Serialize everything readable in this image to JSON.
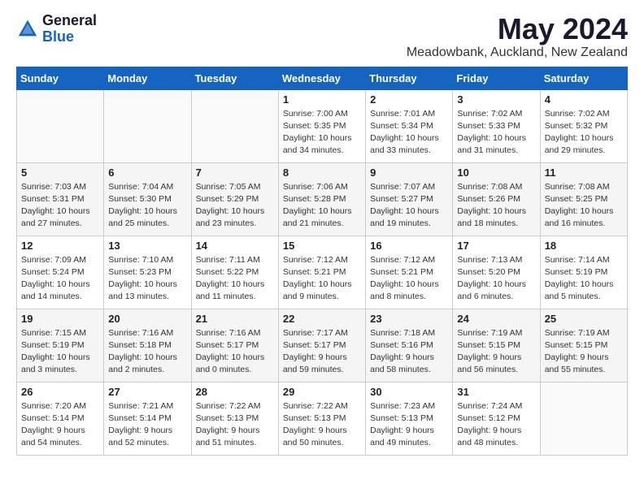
{
  "logo": {
    "general": "General",
    "blue": "Blue"
  },
  "title": "May 2024",
  "location": "Meadowbank, Auckland, New Zealand",
  "headers": [
    "Sunday",
    "Monday",
    "Tuesday",
    "Wednesday",
    "Thursday",
    "Friday",
    "Saturday"
  ],
  "weeks": [
    [
      {
        "day": "",
        "info": ""
      },
      {
        "day": "",
        "info": ""
      },
      {
        "day": "",
        "info": ""
      },
      {
        "day": "1",
        "info": "Sunrise: 7:00 AM\nSunset: 5:35 PM\nDaylight: 10 hours\nand 34 minutes."
      },
      {
        "day": "2",
        "info": "Sunrise: 7:01 AM\nSunset: 5:34 PM\nDaylight: 10 hours\nand 33 minutes."
      },
      {
        "day": "3",
        "info": "Sunrise: 7:02 AM\nSunset: 5:33 PM\nDaylight: 10 hours\nand 31 minutes."
      },
      {
        "day": "4",
        "info": "Sunrise: 7:02 AM\nSunset: 5:32 PM\nDaylight: 10 hours\nand 29 minutes."
      }
    ],
    [
      {
        "day": "5",
        "info": "Sunrise: 7:03 AM\nSunset: 5:31 PM\nDaylight: 10 hours\nand 27 minutes."
      },
      {
        "day": "6",
        "info": "Sunrise: 7:04 AM\nSunset: 5:30 PM\nDaylight: 10 hours\nand 25 minutes."
      },
      {
        "day": "7",
        "info": "Sunrise: 7:05 AM\nSunset: 5:29 PM\nDaylight: 10 hours\nand 23 minutes."
      },
      {
        "day": "8",
        "info": "Sunrise: 7:06 AM\nSunset: 5:28 PM\nDaylight: 10 hours\nand 21 minutes."
      },
      {
        "day": "9",
        "info": "Sunrise: 7:07 AM\nSunset: 5:27 PM\nDaylight: 10 hours\nand 19 minutes."
      },
      {
        "day": "10",
        "info": "Sunrise: 7:08 AM\nSunset: 5:26 PM\nDaylight: 10 hours\nand 18 minutes."
      },
      {
        "day": "11",
        "info": "Sunrise: 7:08 AM\nSunset: 5:25 PM\nDaylight: 10 hours\nand 16 minutes."
      }
    ],
    [
      {
        "day": "12",
        "info": "Sunrise: 7:09 AM\nSunset: 5:24 PM\nDaylight: 10 hours\nand 14 minutes."
      },
      {
        "day": "13",
        "info": "Sunrise: 7:10 AM\nSunset: 5:23 PM\nDaylight: 10 hours\nand 13 minutes."
      },
      {
        "day": "14",
        "info": "Sunrise: 7:11 AM\nSunset: 5:22 PM\nDaylight: 10 hours\nand 11 minutes."
      },
      {
        "day": "15",
        "info": "Sunrise: 7:12 AM\nSunset: 5:21 PM\nDaylight: 10 hours\nand 9 minutes."
      },
      {
        "day": "16",
        "info": "Sunrise: 7:12 AM\nSunset: 5:21 PM\nDaylight: 10 hours\nand 8 minutes."
      },
      {
        "day": "17",
        "info": "Sunrise: 7:13 AM\nSunset: 5:20 PM\nDaylight: 10 hours\nand 6 minutes."
      },
      {
        "day": "18",
        "info": "Sunrise: 7:14 AM\nSunset: 5:19 PM\nDaylight: 10 hours\nand 5 minutes."
      }
    ],
    [
      {
        "day": "19",
        "info": "Sunrise: 7:15 AM\nSunset: 5:19 PM\nDaylight: 10 hours\nand 3 minutes."
      },
      {
        "day": "20",
        "info": "Sunrise: 7:16 AM\nSunset: 5:18 PM\nDaylight: 10 hours\nand 2 minutes."
      },
      {
        "day": "21",
        "info": "Sunrise: 7:16 AM\nSunset: 5:17 PM\nDaylight: 10 hours\nand 0 minutes."
      },
      {
        "day": "22",
        "info": "Sunrise: 7:17 AM\nSunset: 5:17 PM\nDaylight: 9 hours\nand 59 minutes."
      },
      {
        "day": "23",
        "info": "Sunrise: 7:18 AM\nSunset: 5:16 PM\nDaylight: 9 hours\nand 58 minutes."
      },
      {
        "day": "24",
        "info": "Sunrise: 7:19 AM\nSunset: 5:15 PM\nDaylight: 9 hours\nand 56 minutes."
      },
      {
        "day": "25",
        "info": "Sunrise: 7:19 AM\nSunset: 5:15 PM\nDaylight: 9 hours\nand 55 minutes."
      }
    ],
    [
      {
        "day": "26",
        "info": "Sunrise: 7:20 AM\nSunset: 5:14 PM\nDaylight: 9 hours\nand 54 minutes."
      },
      {
        "day": "27",
        "info": "Sunrise: 7:21 AM\nSunset: 5:14 PM\nDaylight: 9 hours\nand 52 minutes."
      },
      {
        "day": "28",
        "info": "Sunrise: 7:22 AM\nSunset: 5:13 PM\nDaylight: 9 hours\nand 51 minutes."
      },
      {
        "day": "29",
        "info": "Sunrise: 7:22 AM\nSunset: 5:13 PM\nDaylight: 9 hours\nand 50 minutes."
      },
      {
        "day": "30",
        "info": "Sunrise: 7:23 AM\nSunset: 5:13 PM\nDaylight: 9 hours\nand 49 minutes."
      },
      {
        "day": "31",
        "info": "Sunrise: 7:24 AM\nSunset: 5:12 PM\nDaylight: 9 hours\nand 48 minutes."
      },
      {
        "day": "",
        "info": ""
      }
    ]
  ]
}
